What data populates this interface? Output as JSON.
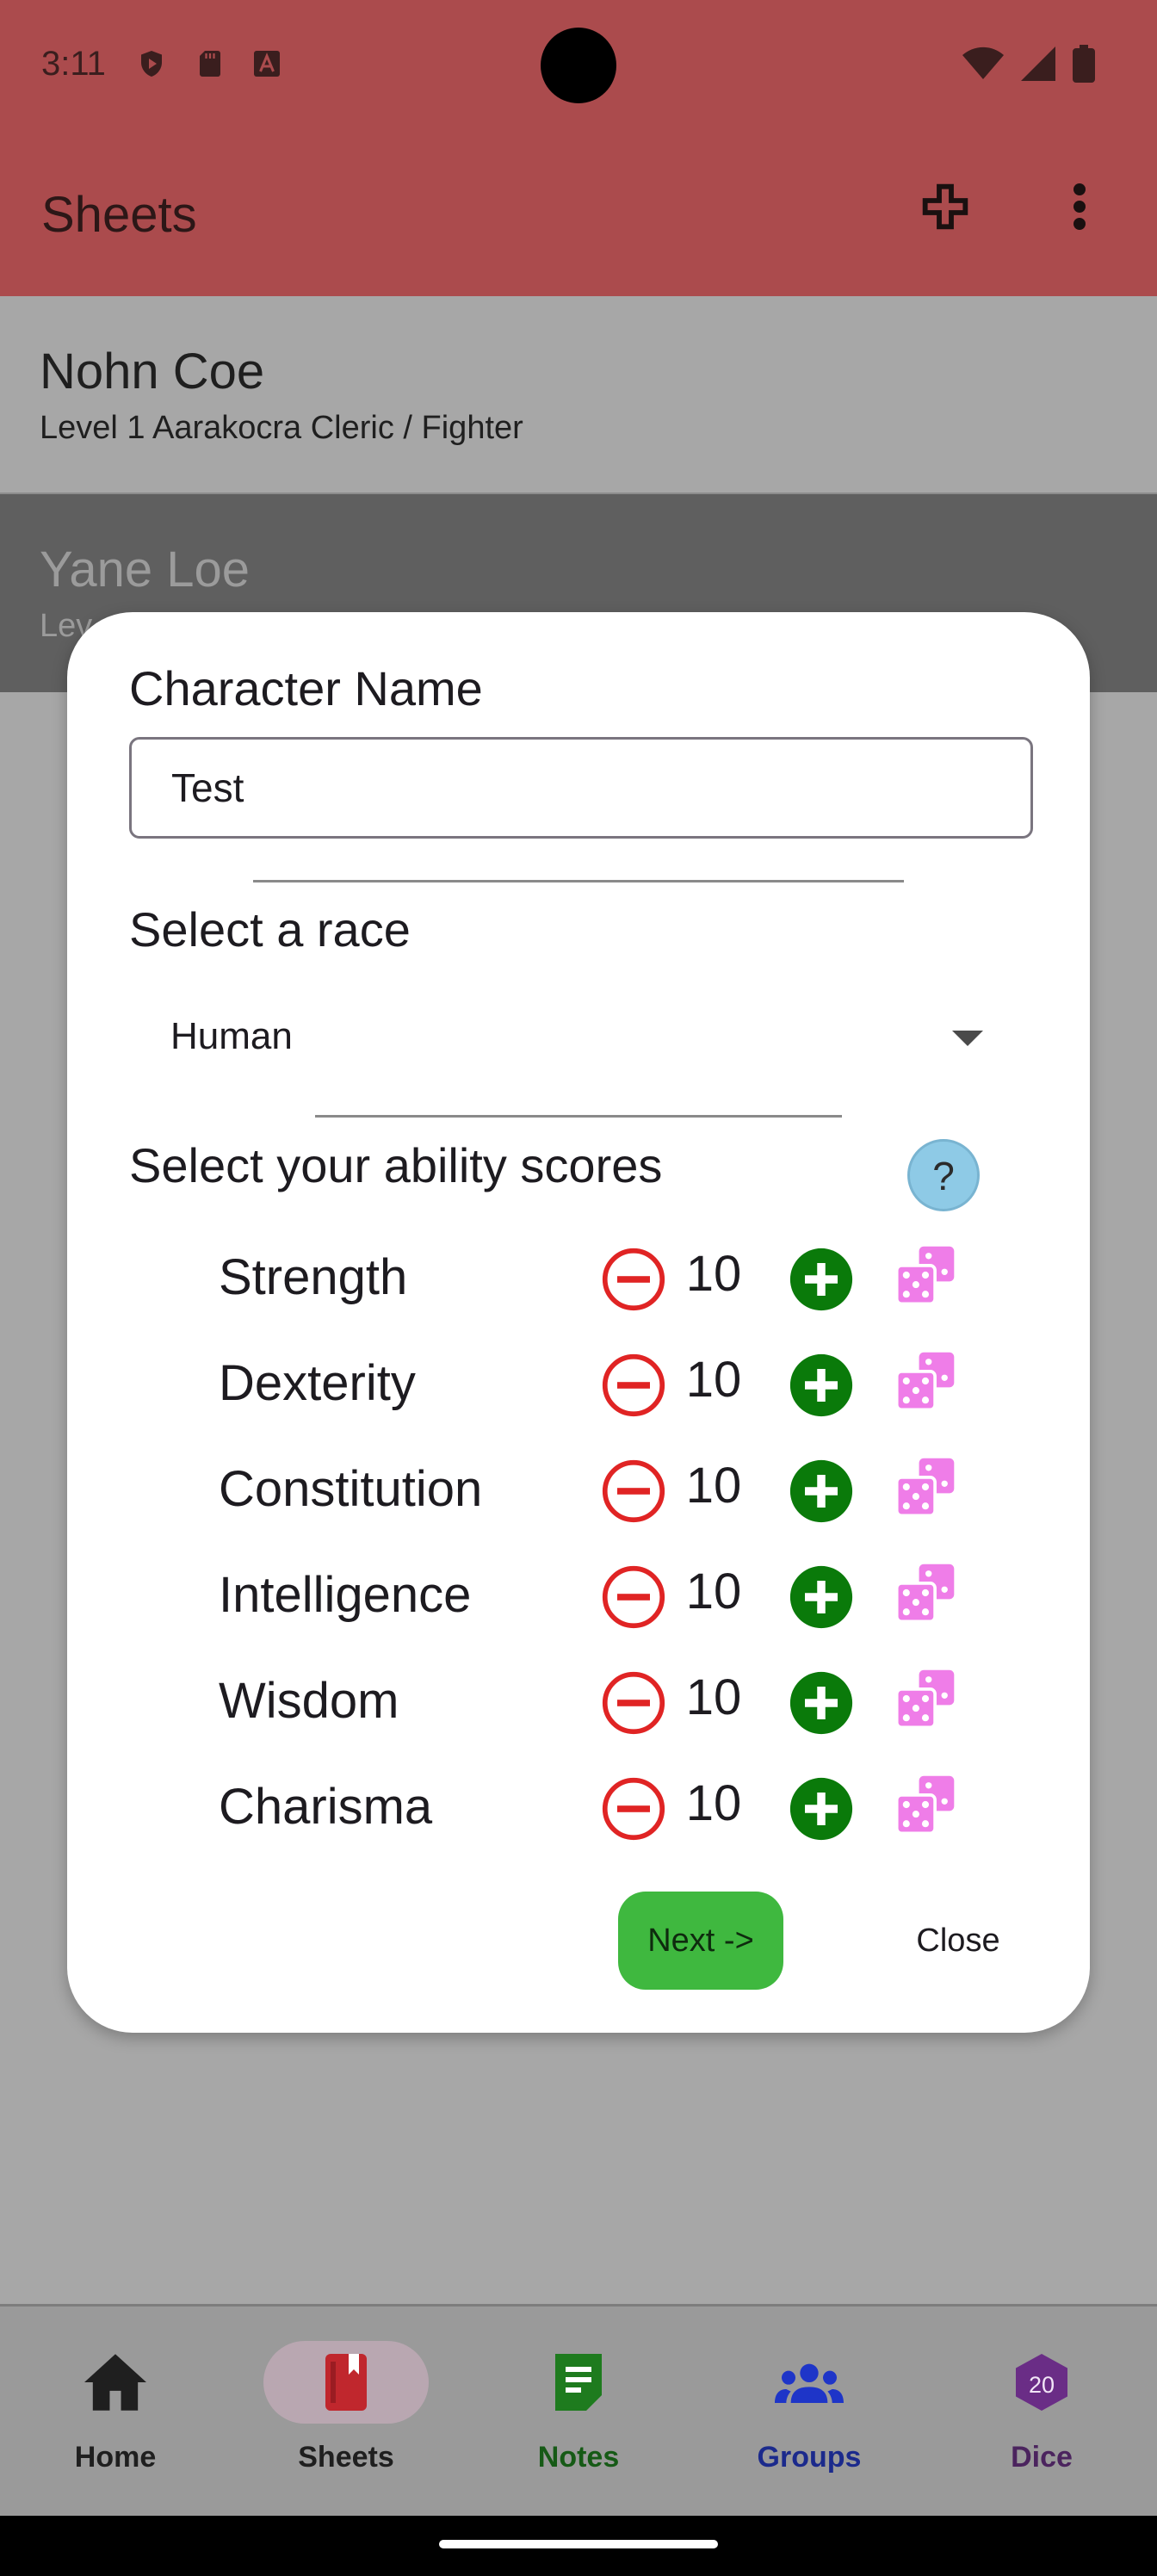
{
  "status_bar": {
    "time": "3:11"
  },
  "app_bar": {
    "title": "Sheets"
  },
  "sheets": [
    {
      "name": "Nohn Coe",
      "subtitle": "Level 1 Aarakocra Cleric / Fighter"
    },
    {
      "name": "Yane Loe",
      "subtitle": "Lev"
    }
  ],
  "dialog": {
    "name_label": "Character Name",
    "name_value": "Test",
    "race_label": "Select a race",
    "race_value": "Human",
    "abilities_label": "Select your ability scores",
    "help_label": "?",
    "abilities": [
      {
        "name": "Strength",
        "value": "10"
      },
      {
        "name": "Dexterity",
        "value": "10"
      },
      {
        "name": "Constitution",
        "value": "10"
      },
      {
        "name": "Intelligence",
        "value": "10"
      },
      {
        "name": "Wisdom",
        "value": "10"
      },
      {
        "name": "Charisma",
        "value": "10"
      }
    ],
    "next_label": "Next ->",
    "close_label": "Close"
  },
  "bottom_nav": {
    "items": [
      {
        "label": "Home",
        "icon": "home-icon",
        "color": "#1f1f1f"
      },
      {
        "label": "Sheets",
        "icon": "book-icon",
        "color": "#1f1f1f",
        "selected": true
      },
      {
        "label": "Notes",
        "icon": "notes-icon",
        "color": "#165a16"
      },
      {
        "label": "Groups",
        "icon": "groups-icon",
        "color": "#1b2a8c"
      },
      {
        "label": "Dice",
        "icon": "d20-icon",
        "color": "#4b245e",
        "badge": "20"
      }
    ]
  },
  "colors": {
    "app_bar": "#ab4b4d",
    "minus": "#e02424",
    "plus": "#0a7a0a",
    "dice": "#ef7de8",
    "next_button": "#3fb83f",
    "help_button": "#8ecae6"
  }
}
